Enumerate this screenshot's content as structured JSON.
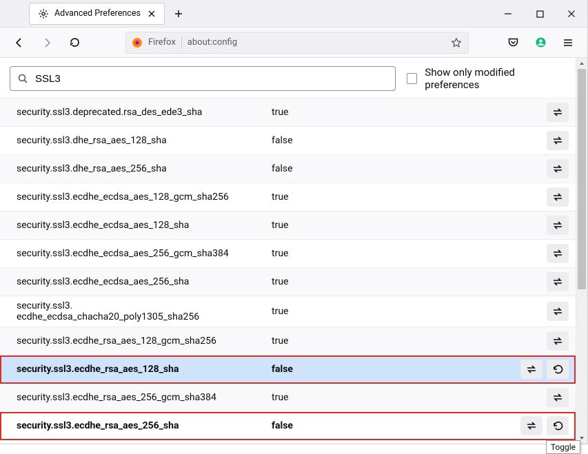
{
  "tab": {
    "title": "Advanced Preferences"
  },
  "urlbar": {
    "identity": "Firefox",
    "url": "about:config"
  },
  "search": {
    "value": "SSL3",
    "checkbox_label": "Show only modified preferences"
  },
  "tooltip": "Toggle",
  "prefs": [
    {
      "name": "security.ssl3.deprecated.rsa_des_ede3_sha",
      "value": "true",
      "modified": false,
      "selected": false,
      "redbox": false,
      "reset": false
    },
    {
      "name": "security.ssl3.dhe_rsa_aes_128_sha",
      "value": "false",
      "modified": false,
      "selected": false,
      "redbox": false,
      "reset": false
    },
    {
      "name": "security.ssl3.dhe_rsa_aes_256_sha",
      "value": "false",
      "modified": false,
      "selected": false,
      "redbox": false,
      "reset": false
    },
    {
      "name": "security.ssl3.ecdhe_ecdsa_aes_128_gcm_sha256",
      "value": "true",
      "modified": false,
      "selected": false,
      "redbox": false,
      "reset": false
    },
    {
      "name": "security.ssl3.ecdhe_ecdsa_aes_128_sha",
      "value": "true",
      "modified": false,
      "selected": false,
      "redbox": false,
      "reset": false
    },
    {
      "name": "security.ssl3.ecdhe_ecdsa_aes_256_gcm_sha384",
      "value": "true",
      "modified": false,
      "selected": false,
      "redbox": false,
      "reset": false
    },
    {
      "name": "security.ssl3.ecdhe_ecdsa_aes_256_sha",
      "value": "true",
      "modified": false,
      "selected": false,
      "redbox": false,
      "reset": false
    },
    {
      "name": "security.ssl3.\necdhe_ecdsa_chacha20_poly1305_sha256",
      "value": "true",
      "modified": false,
      "selected": false,
      "redbox": false,
      "reset": false
    },
    {
      "name": "security.ssl3.ecdhe_rsa_aes_128_gcm_sha256",
      "value": "true",
      "modified": false,
      "selected": false,
      "redbox": false,
      "reset": false
    },
    {
      "name": "security.ssl3.ecdhe_rsa_aes_128_sha",
      "value": "false",
      "modified": true,
      "selected": true,
      "redbox": true,
      "reset": true
    },
    {
      "name": "security.ssl3.ecdhe_rsa_aes_256_gcm_sha384",
      "value": "true",
      "modified": false,
      "selected": false,
      "redbox": false,
      "reset": false
    },
    {
      "name": "security.ssl3.ecdhe_rsa_aes_256_sha",
      "value": "false",
      "modified": true,
      "selected": false,
      "redbox": true,
      "reset": true
    }
  ]
}
